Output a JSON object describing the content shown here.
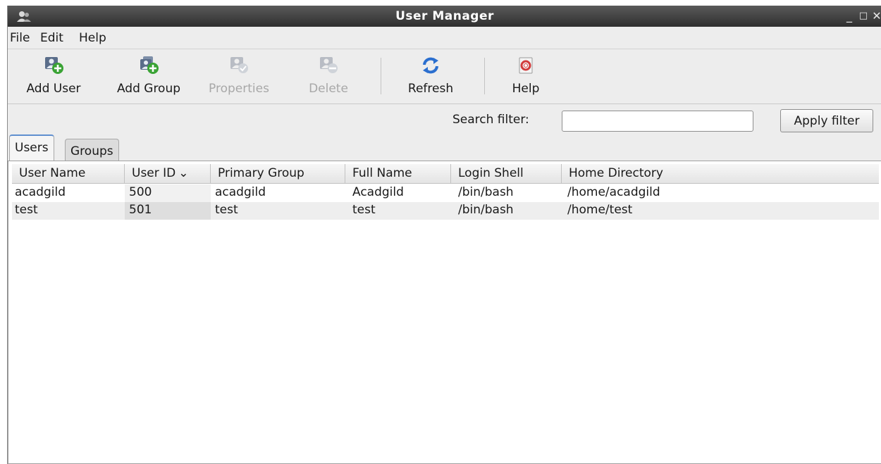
{
  "window": {
    "title": "User Manager",
    "minimize_glyph": "_",
    "maximize_glyph": "□",
    "close_glyph": "✕"
  },
  "menu": {
    "items": [
      {
        "label": "File"
      },
      {
        "label": "Edit"
      },
      {
        "label": "Help"
      }
    ]
  },
  "toolbar": {
    "add_user": {
      "label": "Add User",
      "icon": "add-user-icon",
      "enabled": true
    },
    "add_group": {
      "label": "Add Group",
      "icon": "add-group-icon",
      "enabled": true
    },
    "properties": {
      "label": "Properties",
      "icon": "properties-icon",
      "enabled": false
    },
    "delete": {
      "label": "Delete",
      "icon": "delete-icon",
      "enabled": false
    },
    "refresh": {
      "label": "Refresh",
      "icon": "refresh-icon",
      "enabled": true
    },
    "help": {
      "label": "Help",
      "icon": "help-lifebuoy-icon",
      "enabled": true
    }
  },
  "filter": {
    "label": "Search filter:",
    "value": "",
    "apply_label": "Apply filter"
  },
  "tabs": [
    {
      "label": "Users",
      "active": true
    },
    {
      "label": "Groups",
      "active": false
    }
  ],
  "users_table": {
    "columns": [
      "User Name",
      "User ID",
      "Primary Group",
      "Full Name",
      "Login Shell",
      "Home Directory"
    ],
    "sorted_column": "User ID",
    "sort_indicator": "⌄",
    "rows": [
      [
        "acadgild",
        "500",
        "acadgild",
        "Acadgild",
        "/bin/bash",
        "/home/acadgild"
      ],
      [
        "test",
        "501",
        "test",
        "test",
        "/bin/bash",
        "/home/test"
      ]
    ]
  },
  "colors": {
    "titlebar": "#3c3c3c",
    "window_bg": "#ededed",
    "active_tab_accent": "#5f8fcf",
    "add_badge": "#3aa335",
    "refresh_blue": "#2b6fcf"
  }
}
